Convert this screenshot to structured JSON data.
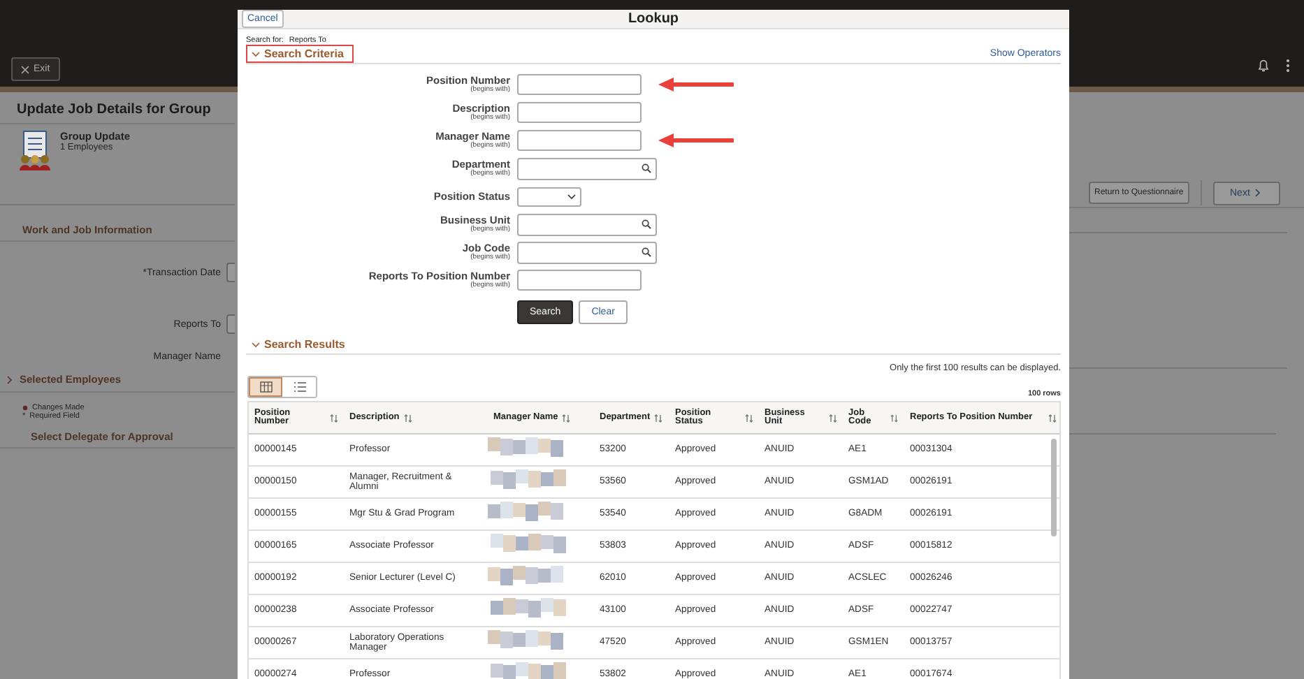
{
  "page": {
    "exit_button": "Exit",
    "title": "Update Job Details for Group",
    "group": {
      "title": "Group Update",
      "subtitle": "1 Employees"
    },
    "sections": [
      {
        "kind": "heading",
        "title": "Work and Job Information"
      },
      {
        "kind": "field",
        "label": "*Transaction Date"
      },
      {
        "kind": "field",
        "label": "Reports To"
      },
      {
        "kind": "label",
        "label": "Manager Name"
      },
      {
        "kind": "collapsible",
        "title": "Selected Employees",
        "expanded": false
      }
    ],
    "legend": [
      {
        "kind": "dot",
        "label": "Changes Made"
      },
      {
        "kind": "symbol",
        "symbol": "*",
        "label": "Required Field"
      }
    ],
    "delegate_title": "Select Delegate for Approval",
    "buttons": [
      "Return to Questionnaire",
      "Next"
    ]
  },
  "lookup": {
    "cancel": "Cancel",
    "title": "Lookup",
    "search_for_label": "Search for:",
    "search_for_value": "Reports To",
    "criteria": {
      "title": "Search Criteria",
      "expanded": true,
      "show_operators": "Show Operators"
    },
    "fields": [
      {
        "kind": "text",
        "label": "Position Number",
        "hint": "(begins with)",
        "highlighted": true
      },
      {
        "kind": "text",
        "label": "Description",
        "hint": "(begins with)",
        "highlighted": false
      },
      {
        "kind": "text",
        "label": "Manager Name",
        "hint": "(begins with)",
        "highlighted": true
      },
      {
        "kind": "lookup",
        "label": "Department",
        "hint": "(begins with)",
        "highlighted": false
      },
      {
        "kind": "select",
        "label": "Position Status",
        "highlighted": false
      },
      {
        "kind": "lookup",
        "label": "Business Unit",
        "hint": "(begins with)",
        "highlighted": false
      },
      {
        "kind": "lookup",
        "label": "Job Code",
        "hint": "(begins with)",
        "highlighted": false
      },
      {
        "kind": "text",
        "label": "Reports To Position Number",
        "hint": "(begins with)",
        "highlighted": false
      }
    ],
    "buttons": [
      {
        "kind": "primary",
        "label": "Search"
      },
      {
        "kind": "secondary",
        "label": "Clear"
      }
    ],
    "results": {
      "title": "Search Results",
      "expanded": true,
      "note": "Only the first 100 results can be displayed.",
      "views": [
        {
          "kind": "grid",
          "selected": true
        },
        {
          "kind": "list",
          "selected": false
        }
      ],
      "row_count": "100 rows",
      "columns": [
        "Position Number",
        "Description",
        "Manager Name",
        "Department",
        "Position Status",
        "Business Unit",
        "Job Code",
        "Reports To Position Number"
      ],
      "rows": [
        [
          "00000145",
          "Professor",
          "",
          "53200",
          "Approved",
          "ANUID",
          "AE1",
          "00031304"
        ],
        [
          "00000150",
          "Manager, Recruitment & Alumni",
          "",
          "53560",
          "Approved",
          "ANUID",
          "GSM1AD",
          "00026191"
        ],
        [
          "00000155",
          "Mgr Stu & Grad Program",
          "",
          "53540",
          "Approved",
          "ANUID",
          "G8ADM",
          "00026191"
        ],
        [
          "00000165",
          "Associate Professor",
          "",
          "53803",
          "Approved",
          "ANUID",
          "ADSF",
          "00015812"
        ],
        [
          "00000192",
          "Senior Lecturer (Level C)",
          "",
          "62010",
          "Approved",
          "ANUID",
          "ACSLEC",
          "00026246"
        ],
        [
          "00000238",
          "Associate Professor",
          "",
          "43100",
          "Approved",
          "ANUID",
          "ADSF",
          "00022747"
        ],
        [
          "00000267",
          "Laboratory Operations Manager",
          "",
          "47520",
          "Approved",
          "ANUID",
          "GSM1EN",
          "00013757"
        ],
        [
          "00000274",
          "Professor",
          "",
          "53802",
          "Approved",
          "ANUID",
          "AE1",
          "00017674"
        ]
      ]
    }
  }
}
